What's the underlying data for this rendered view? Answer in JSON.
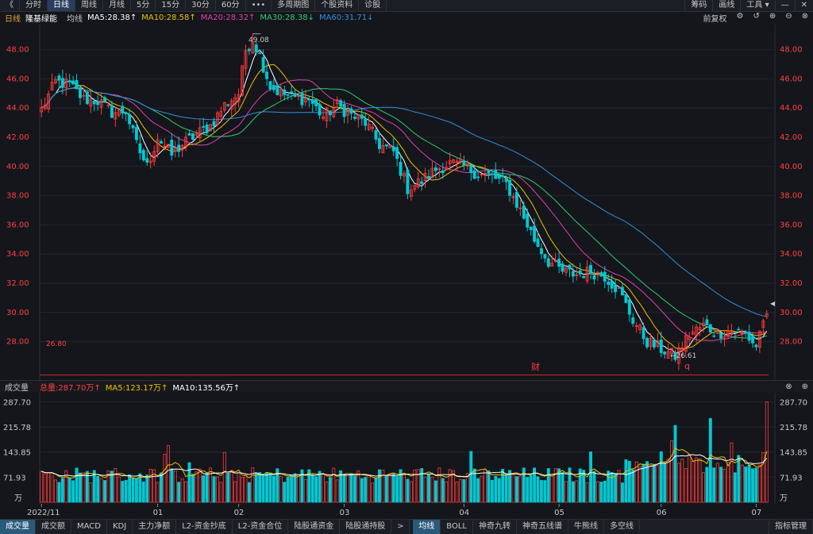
{
  "toolbar": {
    "back": "《",
    "periods": [
      "分时",
      "日线",
      "周线",
      "月线",
      "5分",
      "15分",
      "30分",
      "60分"
    ],
    "active_period": "日线",
    "more": "•••",
    "multi_period": "多周期图",
    "stock_info": "个股资料",
    "diagnose": "诊股",
    "chips": "筹码",
    "draw": "画线",
    "tools": "工具 ▾",
    "minimize": "—",
    "close": "✕"
  },
  "indicator_row": {
    "period": "日线",
    "stock_name": "隆基绿能",
    "ma_label": "均线",
    "ma5": "MA5:28.38↑",
    "ma10": "MA10:28.58↑",
    "ma20": "MA20:28.32↑",
    "ma30": "MA30:28.38↓",
    "ma60": "MA60:31.71↓",
    "adjust": "前复权",
    "colors": {
      "ma5": "#ffffff",
      "ma10": "#f2c200",
      "ma20": "#e040b0",
      "ma30": "#2ecc71",
      "ma60": "#2f8fe0"
    }
  },
  "price_axis": {
    "min": 27.0,
    "max": 49.5,
    "ticks": [
      "48.00",
      "46.00",
      "44.00",
      "42.00",
      "40.00",
      "38.00",
      "36.00",
      "34.00",
      "32.00",
      "30.00",
      "28.00"
    ]
  },
  "annotations": {
    "high_label": "49.08",
    "low_label": "←26.61",
    "ref_line_label": "26.80",
    "ref_line_value": 26.8,
    "fin_marker": "财",
    "q_marker": "q"
  },
  "volume_header": {
    "title": "成交量",
    "total": "总量:287.70万↑",
    "ma5": "MA5:123.17万↑",
    "ma10": "MA10:135.56万↑"
  },
  "volume_axis": {
    "ticks": [
      "287.70",
      "215.78",
      "143.85",
      "71.93"
    ],
    "unit": "万"
  },
  "x_axis": {
    "labels": [
      "2022/11",
      "01",
      "02",
      "03",
      "04",
      "05",
      "06",
      "07"
    ]
  },
  "bottom_tabs_left": [
    "成交量",
    "成交额",
    "MACD",
    "KDJ",
    "主力净额",
    "L2-资金抄底",
    "L2-资金合位",
    "陆股通资金",
    "陆股通持股"
  ],
  "bottom_tabs_right": [
    "均线",
    "BOLL",
    "神奇九转",
    "神奇五线谱",
    "牛熊线",
    "多空线"
  ],
  "bottom_manage": "指标管理",
  "bottom_arrow": ">",
  "chart_data": {
    "type": "candlestick",
    "series_colors": {
      "up": "#ff3b3b",
      "down": "#00c8d2"
    },
    "anchor_closes": [
      [
        0,
        43.9
      ],
      [
        4,
        45.8
      ],
      [
        8,
        45.6
      ],
      [
        12,
        44.6
      ],
      [
        16,
        44.5
      ],
      [
        20,
        43.7
      ],
      [
        24,
        43.8
      ],
      [
        27,
        41.5
      ],
      [
        30,
        40.0
      ],
      [
        33,
        42.0
      ],
      [
        37,
        40.8
      ],
      [
        40,
        41.5
      ],
      [
        44,
        42.2
      ],
      [
        48,
        42.8
      ],
      [
        52,
        44.2
      ],
      [
        56,
        45.0
      ],
      [
        58,
        48.0
      ],
      [
        60,
        48.7
      ],
      [
        62,
        47.6
      ],
      [
        65,
        45.5
      ],
      [
        68,
        45.0
      ],
      [
        72,
        44.7
      ],
      [
        76,
        44.6
      ],
      [
        80,
        43.4
      ],
      [
        84,
        44.2
      ],
      [
        88,
        43.5
      ],
      [
        92,
        43.0
      ],
      [
        96,
        41.5
      ],
      [
        100,
        41.0
      ],
      [
        104,
        38.5
      ],
      [
        108,
        39.0
      ],
      [
        112,
        39.8
      ],
      [
        116,
        40.2
      ],
      [
        120,
        40.0
      ],
      [
        124,
        39.5
      ],
      [
        128,
        39.3
      ],
      [
        132,
        38.8
      ],
      [
        136,
        37.0
      ],
      [
        140,
        35.0
      ],
      [
        144,
        33.5
      ],
      [
        148,
        32.8
      ],
      [
        152,
        32.6
      ],
      [
        156,
        32.8
      ],
      [
        160,
        32.5
      ],
      [
        164,
        31.5
      ],
      [
        168,
        29.5
      ],
      [
        172,
        28.0
      ],
      [
        176,
        27.5
      ],
      [
        180,
        27.0
      ],
      [
        184,
        28.5
      ],
      [
        188,
        29.1
      ],
      [
        192,
        28.6
      ],
      [
        196,
        28.8
      ],
      [
        200,
        28.5
      ],
      [
        203,
        27.7
      ],
      [
        205,
        29.6
      ]
    ],
    "volume_max": 300,
    "volume_ticks": [
      287.7,
      215.78,
      143.85,
      71.93
    ],
    "last_volume": 287.7
  }
}
